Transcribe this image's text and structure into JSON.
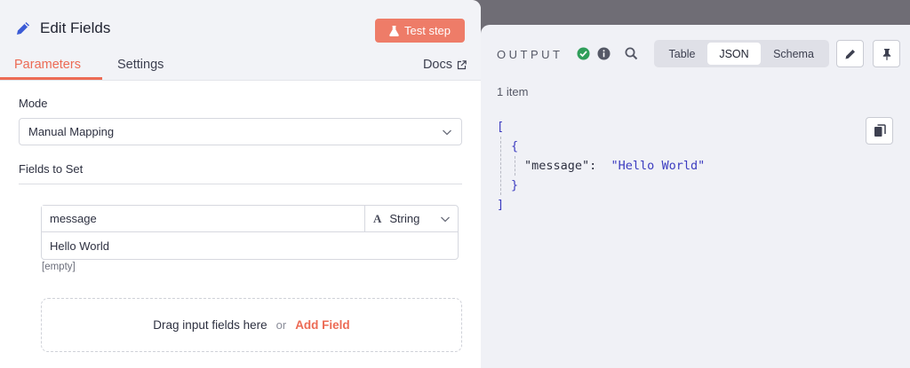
{
  "node": {
    "title": "Edit Fields",
    "test_step_label": "Test step",
    "tabs": [
      {
        "label": "Parameters",
        "active": true
      },
      {
        "label": "Settings",
        "active": false
      }
    ],
    "docs_label": "Docs"
  },
  "parameters": {
    "mode_label": "Mode",
    "mode_value": "Manual Mapping",
    "fields_label": "Fields to Set",
    "field": {
      "name": "message",
      "type": "String",
      "value": "Hello World",
      "hint": "[empty]"
    },
    "drop_text": "Drag input fields here",
    "or_text": "or",
    "add_field_label": "Add Field"
  },
  "output": {
    "title": "OUTPUT",
    "views": [
      "Table",
      "JSON",
      "Schema"
    ],
    "active_view": "JSON",
    "item_count": "1 item",
    "json_lines": {
      "open_array": "[",
      "open_object": "{",
      "key": "\"message\":",
      "value": "\"Hello World\"",
      "close_object": "}",
      "close_array": "]"
    }
  },
  "colors": {
    "accent": "#ec6b55",
    "success": "#2f9e5a",
    "json_bracket": "#3c3cc0"
  }
}
